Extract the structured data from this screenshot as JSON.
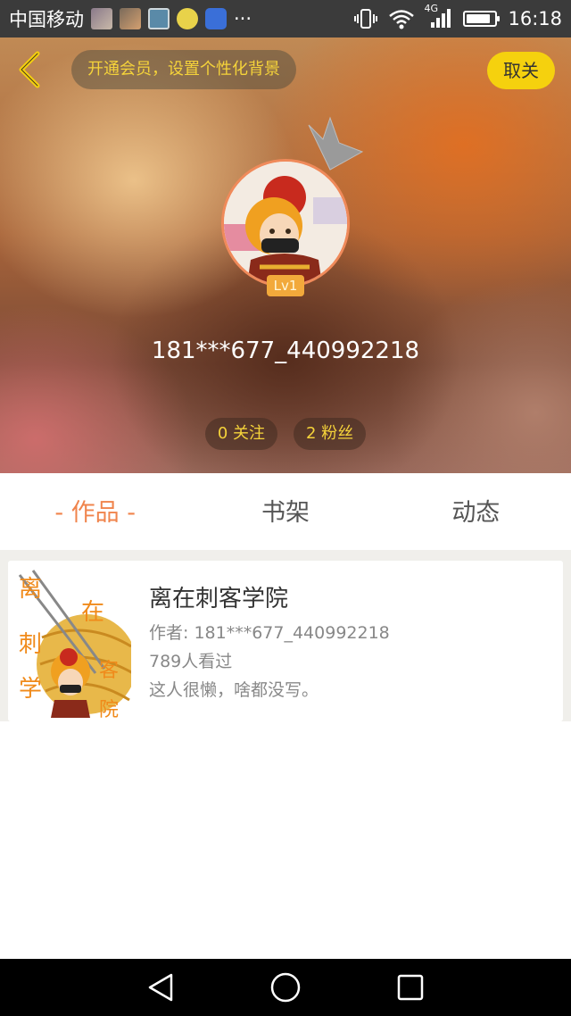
{
  "status_bar": {
    "carrier": "中国移动",
    "more": "···",
    "network": "4G",
    "time": "16:18",
    "battery_level": 0.85
  },
  "header": {
    "vip_banner": "开通会员，设置个性化背景",
    "cancel_follow": "取关",
    "level": "Lv1",
    "username": "181***677_440992218",
    "following": "0 关注",
    "followers": "2 粉丝"
  },
  "tabs": [
    {
      "label": "- 作品 -",
      "active": true
    },
    {
      "label": "书架",
      "active": false
    },
    {
      "label": "动态",
      "active": false
    }
  ],
  "works": [
    {
      "title": "离在刺客学院",
      "author": "作者: 181***677_440992218",
      "views": "789人看过",
      "description": "这人很懒，啥都没写。",
      "cover_text": [
        "离",
        "在",
        "刺",
        "学",
        "院",
        "客"
      ]
    }
  ],
  "colors": {
    "accent": "#f0844c",
    "yellow": "#f5d10e",
    "vip_text": "#f5d33a"
  }
}
